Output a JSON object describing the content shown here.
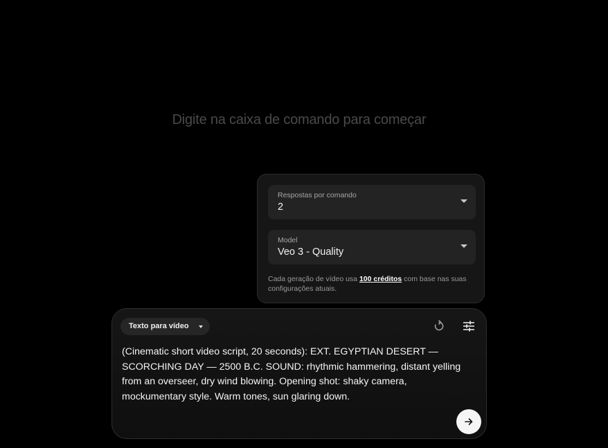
{
  "empty_state": {
    "hint": "Digite na caixa de comando para começar"
  },
  "settings": {
    "outputs": {
      "label": "Respostas por comando",
      "value": "2"
    },
    "model": {
      "label": "Model",
      "value": "Veo 3 - Quality"
    },
    "credits_note": {
      "before": "Cada geração de vídeo usa ",
      "link": "100 créditos",
      "after": " com base nas suas configurações atuais."
    }
  },
  "composer": {
    "mode_label": "Texto para vídeo",
    "prompt": "(Cinematic short video script, 20 seconds): EXT. EGYPTIAN DESERT — SCORCHING DAY — 2500 B.C. SOUND: rhythmic hammering, distant yelling from an overseer, dry wind blowing. Opening shot: shaky camera, mockumentary style. Warm tones, sun glaring down.",
    "icons": {
      "mode_caret": "caret-down-icon",
      "reset": "reset-icon",
      "settings": "tune-sliders-icon",
      "send": "arrow-right-icon"
    }
  },
  "colors": {
    "background": "#000000",
    "panel": "#161616",
    "field": "#232323",
    "send_button": "#f5f5f5"
  }
}
